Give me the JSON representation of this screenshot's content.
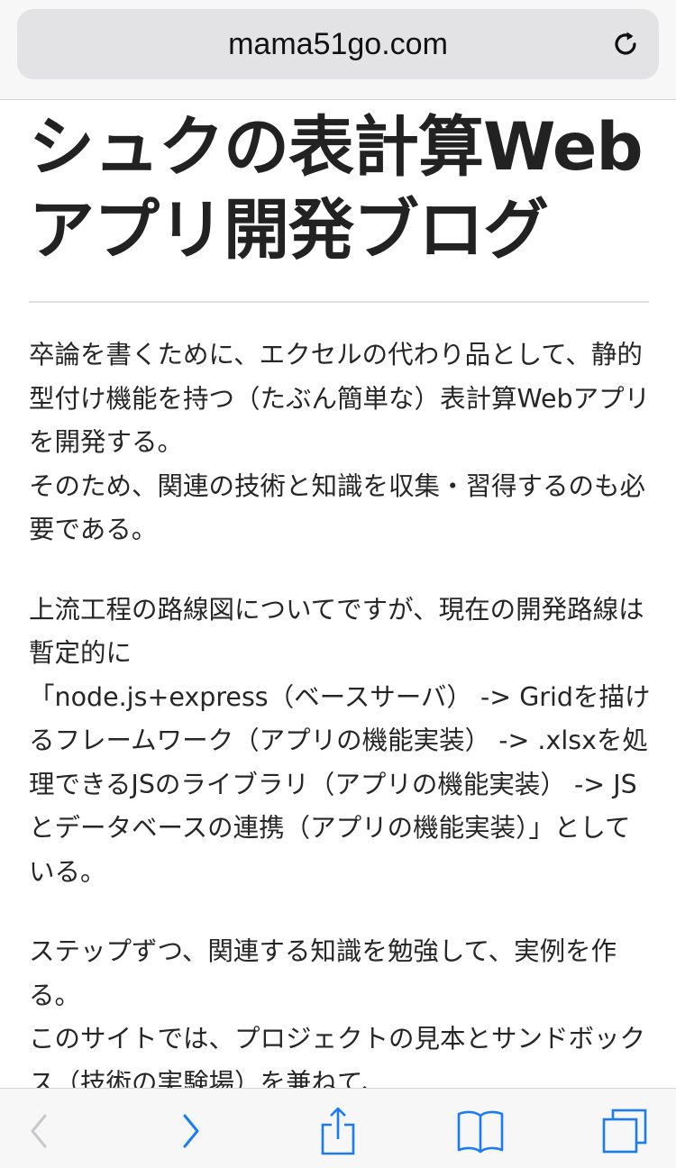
{
  "browser": {
    "url": "mama51go.com",
    "accent": "#1a7cf5"
  },
  "page": {
    "title": "シュクの表計算Webアプリ開発ブログ",
    "paragraphs": [
      "卒論を書くために、エクセルの代わり品として、静的型付け機能を持つ（たぶん簡単な）表計算Webアプリを開発する。\nそのため、関連の技術と知識を収集・習得するのも必要である。",
      "上流工程の路線図についてですが、現在の開発路線は暫定的に\n「node.js+express（ベースサーバ） -> Gridを描けるフレームワーク（アプリの機能実装） -> .xlsxを処理できるJSのライブラリ（アプリの機能実装） -> JSとデータベースの連携（アプリの機能実装）」としている。",
      "ステップずつ、関連する知識を勉強して、実例を作る。\nこのサイトでは、プロジェクトの見本とサンドボックス（技術の実験場）を兼ねて、"
    ]
  },
  "toolbar": {
    "icons": [
      "back-icon",
      "forward-icon",
      "share-icon",
      "bookmarks-icon",
      "tabs-icon"
    ]
  }
}
